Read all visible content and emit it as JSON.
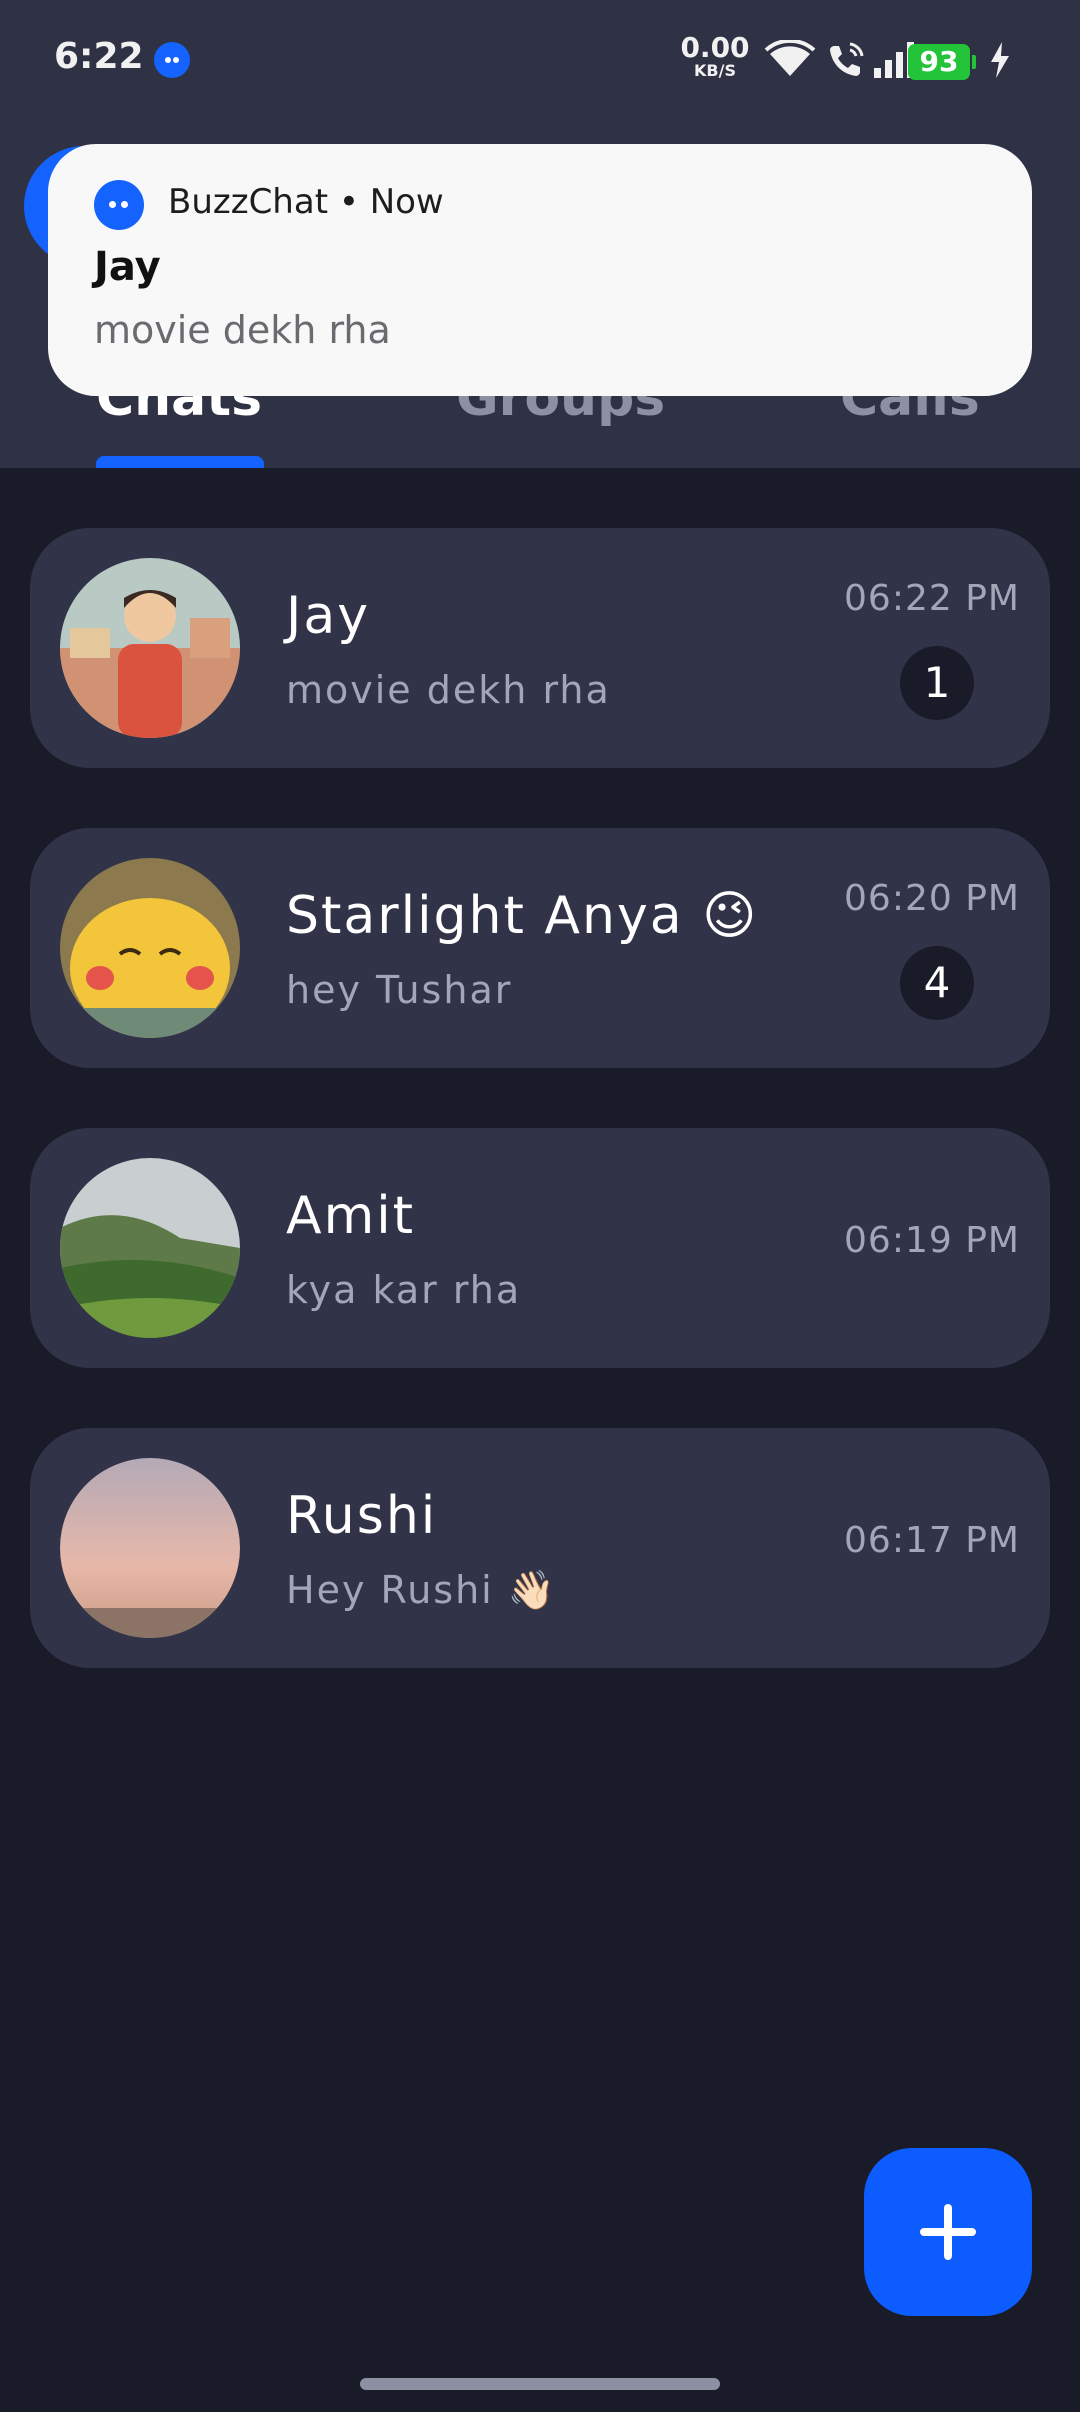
{
  "status_bar": {
    "time": "6:22",
    "net_speed_value": "0.00",
    "net_speed_unit": "KB/S",
    "battery": "93",
    "icons": [
      "buzzchat-icon",
      "wifi-icon",
      "wifi-call-icon",
      "signal-icon",
      "battery-icon",
      "charging-icon"
    ]
  },
  "tabs": [
    {
      "label": "Chats"
    },
    {
      "label": "Groups"
    },
    {
      "label": "Calls"
    }
  ],
  "notification": {
    "app_line": "BuzzChat • Now",
    "title": "Jay",
    "body": "movie dekh rha"
  },
  "chats": [
    {
      "name": "Jay",
      "message": "movie dekh rha",
      "time": "06:22 PM",
      "unread": "1"
    },
    {
      "name": "Starlight Anya 😉",
      "message": "hey Tushar",
      "time": "06:20 PM",
      "unread": "4"
    },
    {
      "name": "Amit",
      "message": "kya kar rha",
      "time": "06:19 PM",
      "unread": ""
    },
    {
      "name": "Rushi",
      "message": "Hey Rushi 👋🏻",
      "time": "06:17 PM",
      "unread": ""
    }
  ],
  "colors": {
    "accent": "#1463ff",
    "background": "#1a1b29",
    "card": "#313348",
    "header": "#2f3144"
  },
  "fab": {
    "icon": "plus-icon"
  }
}
